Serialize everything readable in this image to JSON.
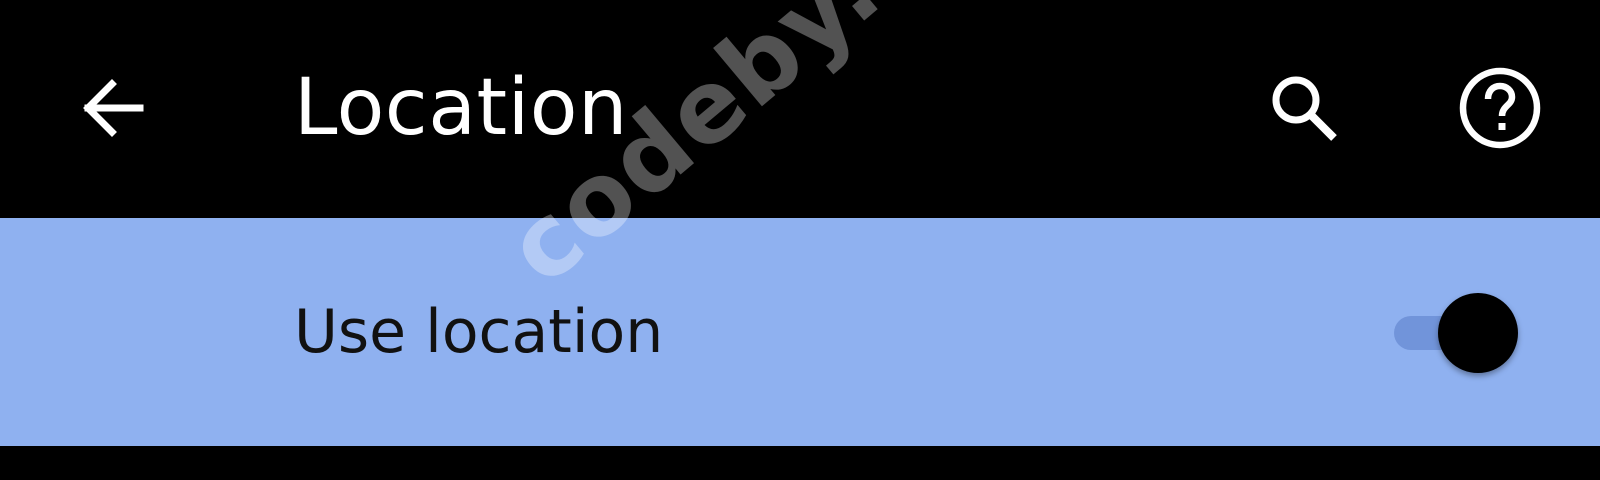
{
  "app_bar": {
    "title": "Location",
    "icons": {
      "back": "arrow-back-icon",
      "search": "search-icon",
      "help": "help-circle-icon"
    }
  },
  "setting": {
    "label": "Use location",
    "switch_state": "on"
  },
  "watermark": {
    "text": "codeby.net"
  },
  "colors": {
    "app_bar_bg": "#000000",
    "icon_color": "#ffffff",
    "row_bg": "#8fb1f0",
    "track_color": "#5a7cc8",
    "thumb_color": "#000000",
    "label_color": "#111111"
  }
}
